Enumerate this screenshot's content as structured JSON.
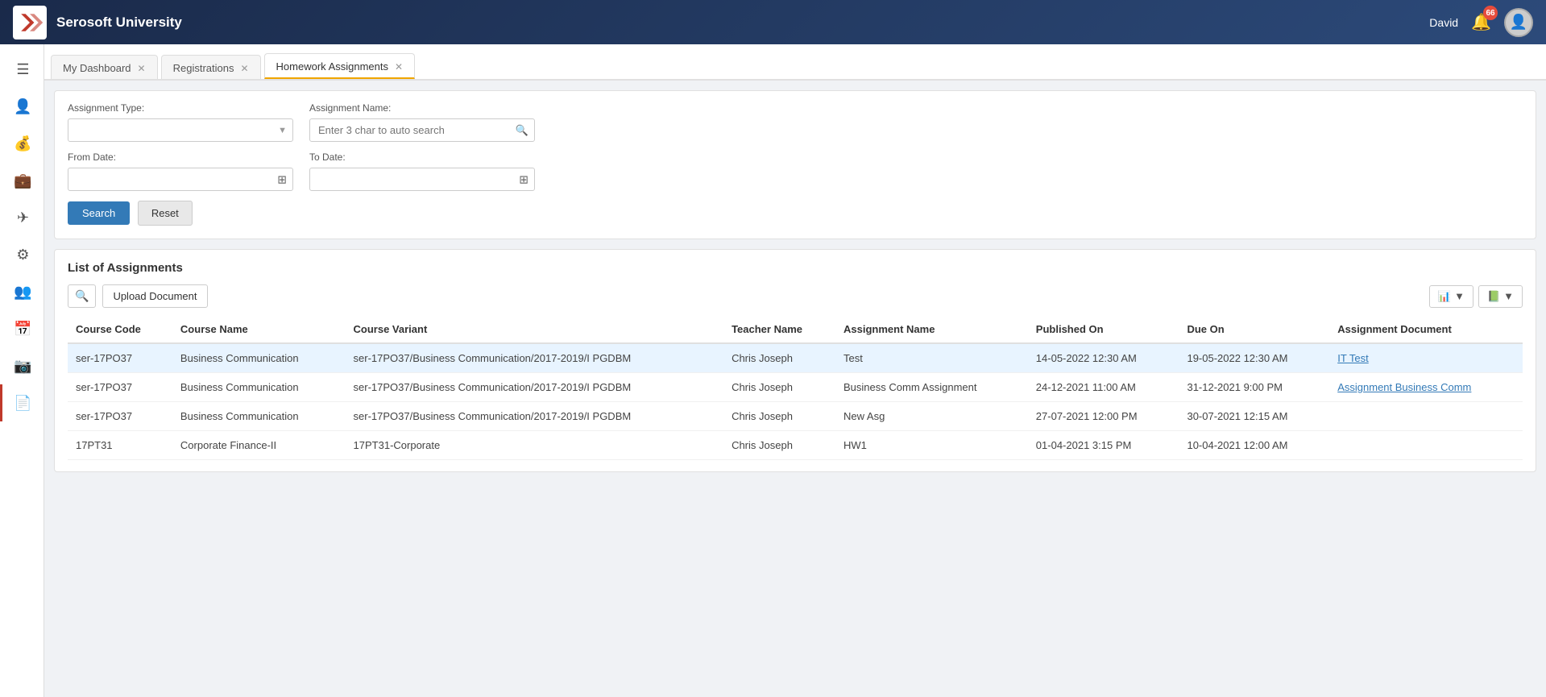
{
  "app": {
    "title": "Serosoft University",
    "user": "David",
    "badge_count": "66"
  },
  "tabs": [
    {
      "id": "my-dashboard",
      "label": "My Dashboard",
      "active": false,
      "closeable": true
    },
    {
      "id": "registrations",
      "label": "Registrations",
      "active": false,
      "closeable": true
    },
    {
      "id": "homework-assignments",
      "label": "Homework Assignments",
      "active": true,
      "closeable": true
    }
  ],
  "sidebar": {
    "items": [
      {
        "id": "menu",
        "icon": "☰",
        "label": "Menu"
      },
      {
        "id": "person",
        "icon": "👤",
        "label": "Person"
      },
      {
        "id": "finance",
        "icon": "💰",
        "label": "Finance"
      },
      {
        "id": "briefcase",
        "icon": "💼",
        "label": "Briefcase"
      },
      {
        "id": "navigation",
        "icon": "✈",
        "label": "Navigation"
      },
      {
        "id": "settings",
        "icon": "⚙",
        "label": "Settings"
      },
      {
        "id": "users",
        "icon": "👥",
        "label": "Users"
      },
      {
        "id": "calendar",
        "icon": "📅",
        "label": "Calendar"
      },
      {
        "id": "camera",
        "icon": "📷",
        "label": "Camera"
      },
      {
        "id": "document",
        "icon": "📄",
        "label": "Document"
      }
    ]
  },
  "filters": {
    "assignment_type_label": "Assignment Type:",
    "assignment_type_placeholder": "",
    "assignment_name_label": "Assignment Name:",
    "assignment_name_placeholder": "Enter 3 char to auto search",
    "from_date_label": "From Date:",
    "from_date_value": "",
    "to_date_label": "To Date:",
    "to_date_value": "",
    "search_button": "Search",
    "reset_button": "Reset"
  },
  "list": {
    "title": "List of Assignments",
    "upload_button": "Upload Document",
    "columns": [
      "Course Code",
      "Course Name",
      "Course Variant",
      "Teacher Name",
      "Assignment Name",
      "Published On",
      "Due On",
      "Assignment Document"
    ],
    "rows": [
      {
        "course_code": "ser-17PO37",
        "course_name": "Business Communication",
        "course_variant": "ser-17PO37/Business Communication/2017-2019/I PGDBM",
        "teacher_name": "Chris Joseph",
        "assignment_name": "Test",
        "published_on": "14-05-2022 12:30 AM",
        "due_on": "19-05-2022 12:30 AM",
        "assignment_document": "IT Test",
        "document_link": true,
        "highlighted": true
      },
      {
        "course_code": "ser-17PO37",
        "course_name": "Business Communication",
        "course_variant": "ser-17PO37/Business Communication/2017-2019/I PGDBM",
        "teacher_name": "Chris Joseph",
        "assignment_name": "Business Comm Assignment",
        "published_on": "24-12-2021 11:00 AM",
        "due_on": "31-12-2021 9:00 PM",
        "assignment_document": "Assignment Business Comm",
        "document_link": true,
        "highlighted": false
      },
      {
        "course_code": "ser-17PO37",
        "course_name": "Business Communication",
        "course_variant": "ser-17PO37/Business Communication/2017-2019/I PGDBM",
        "teacher_name": "Chris Joseph",
        "assignment_name": "New Asg",
        "published_on": "27-07-2021 12:00 PM",
        "due_on": "30-07-2021 12:15 AM",
        "assignment_document": "",
        "document_link": false,
        "highlighted": false
      },
      {
        "course_code": "17PT31",
        "course_name": "Corporate Finance-II",
        "course_variant": "17PT31-Corporate",
        "teacher_name": "Chris Joseph",
        "assignment_name": "HW1",
        "published_on": "01-04-2021 3:15 PM",
        "due_on": "10-04-2021 12:00 AM",
        "assignment_document": "",
        "document_link": false,
        "highlighted": false
      }
    ]
  }
}
